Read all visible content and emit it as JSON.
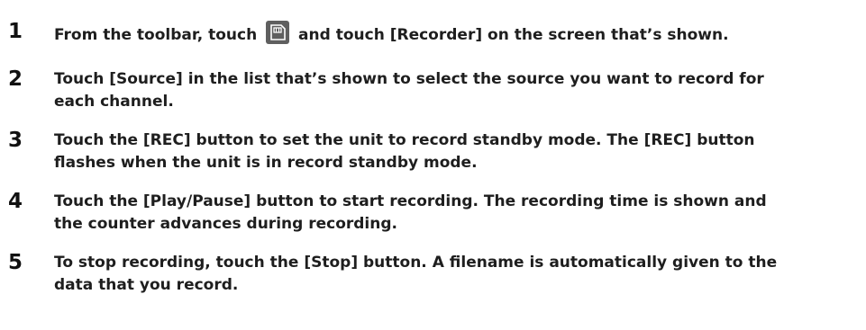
{
  "steps": [
    {
      "number": "1",
      "text_before_icon": "From the toolbar, touch",
      "icon": "recorder-sd-card-icon",
      "text_after_icon": "and touch [Recorder] on the screen that’s shown."
    },
    {
      "number": "2",
      "line1": "Touch [Source] in the list that’s shown to select the source you want to record for",
      "line2": "each channel."
    },
    {
      "number": "3",
      "line1": "Touch the [REC] button to set the unit to record standby mode. The [REC] button",
      "line2": "flashes when the unit is in record standby mode."
    },
    {
      "number": "4",
      "line1": "Touch the [Play/Pause] button to start recording. The recording time is shown and",
      "line2": "the counter advances during recording."
    },
    {
      "number": "5",
      "line1": "To stop recording, touch the [Stop] button. A filename is automatically given to the",
      "line2": "data that you record."
    }
  ]
}
